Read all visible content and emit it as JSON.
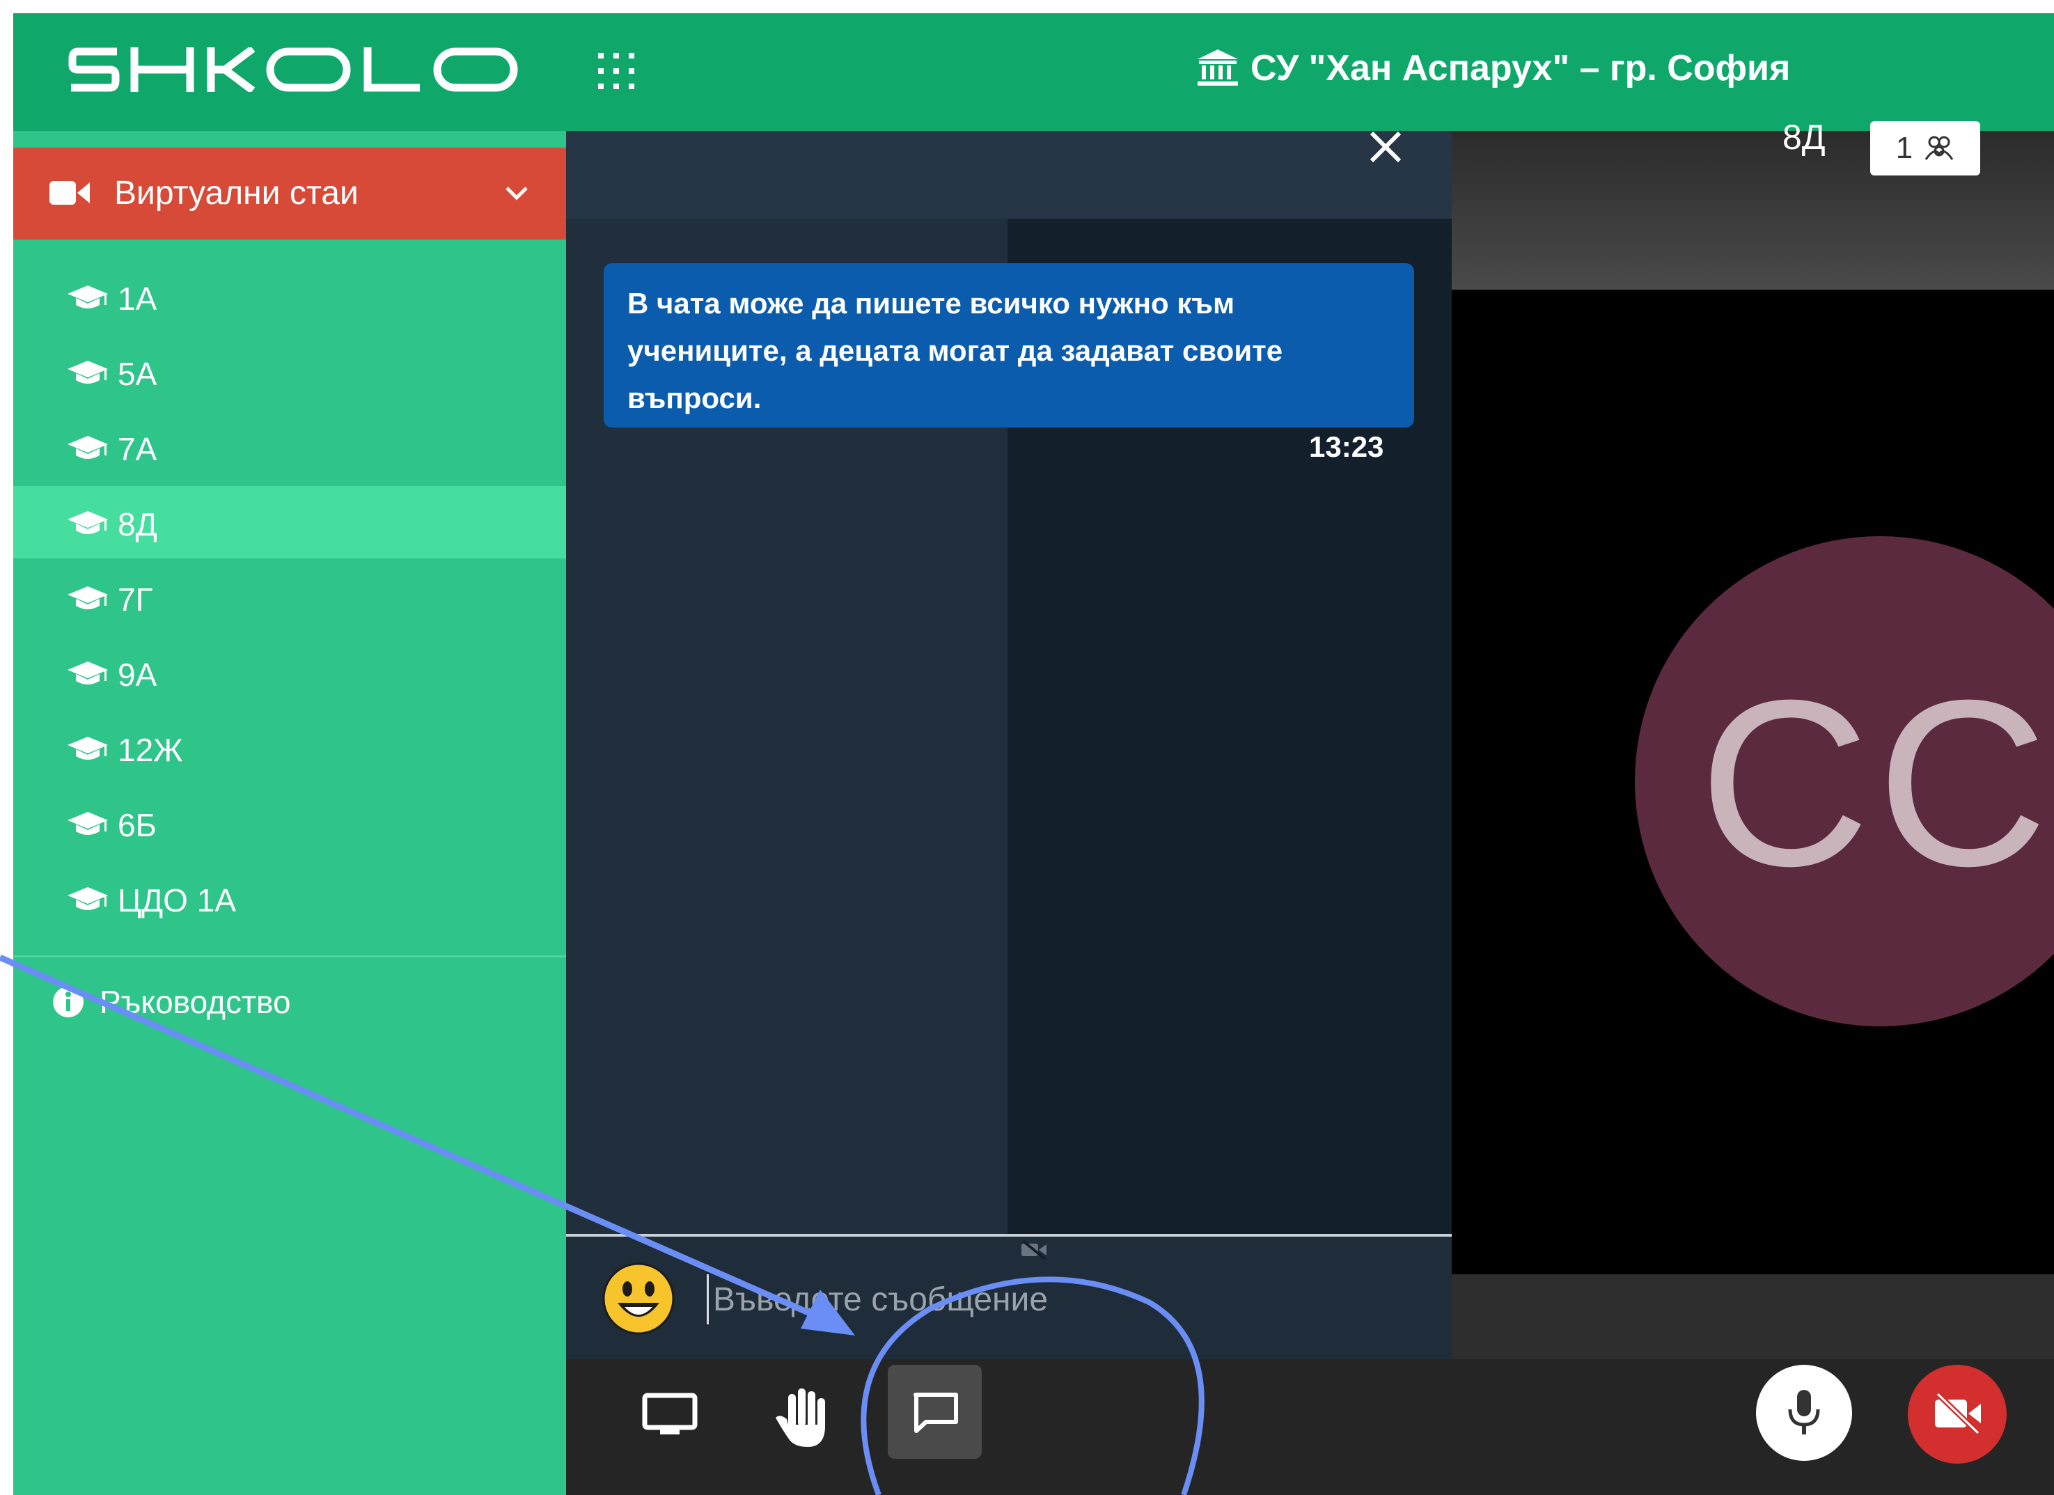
{
  "header": {
    "logo_text": "SHKOLO",
    "school_name": "СУ \"Хан Аспарух\" – гр. София"
  },
  "sidebar": {
    "section_label": "Виртуални стаи",
    "items": [
      {
        "label": "1А"
      },
      {
        "label": "5А"
      },
      {
        "label": "7А"
      },
      {
        "label": "8Д",
        "active": true
      },
      {
        "label": "7Г"
      },
      {
        "label": "9А"
      },
      {
        "label": "12Ж"
      },
      {
        "label": "6Б"
      },
      {
        "label": "ЦДО 1А"
      }
    ],
    "guide_label": "Ръководство"
  },
  "chat": {
    "message": "В чата може да пишете всичко нужно към учениците, а децата могат да задават своите въпроси.",
    "time": "13:23",
    "input_placeholder": "Въведете съобщение"
  },
  "video": {
    "room_name": "8Д",
    "participant_count": "1",
    "avatar_initials": "CC"
  },
  "colors": {
    "brand_green": "#0fa86a",
    "sidebar_green": "#2ec48a",
    "active_item": "#46de9f",
    "rooms_header_red": "#d84a38",
    "bubble_blue": "#0b5cad",
    "annotation_blue": "#6a8ef5"
  },
  "icons": {
    "apps": "grid-icon",
    "school": "bank-icon",
    "rooms": "video-camera-icon",
    "class": "graduation-cap-icon",
    "guide": "info-icon",
    "close": "close-icon",
    "screen_share": "monitor-icon",
    "raise_hand": "hand-icon",
    "chat": "chat-bubble-icon",
    "mic": "microphone-icon",
    "camera_off": "video-off-icon"
  }
}
